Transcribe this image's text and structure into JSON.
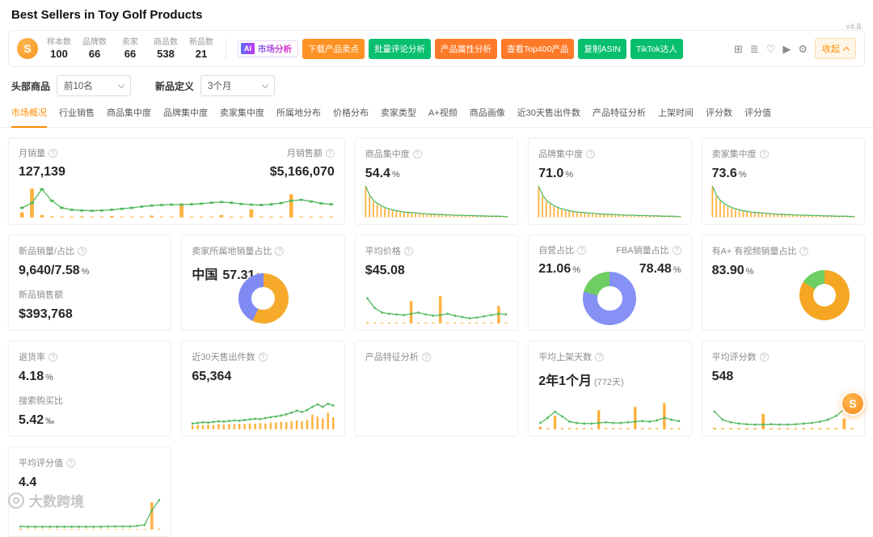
{
  "page": {
    "title": "Best Sellers in Toy Golf Products",
    "version": "v4.8.",
    "watermark": "大数跨境",
    "logo_letter": "S",
    "float_logo_letter": "S",
    "collapse_label": "收起"
  },
  "header": {
    "stats": [
      {
        "label": "样本数",
        "value": "100"
      },
      {
        "label": "品牌数",
        "value": "66"
      },
      {
        "label": "卖家",
        "value": "66"
      },
      {
        "label": "商品数",
        "value": "538"
      },
      {
        "label": "新品数",
        "value": "21"
      }
    ],
    "ai_button": {
      "badge": "AI",
      "label": "市场分析"
    },
    "buttons": [
      {
        "label": "下载产品卖点",
        "color": "#ff9224"
      },
      {
        "label": "批量评论分析",
        "color": "#08bf6e"
      },
      {
        "label": "产品属性分析",
        "color": "#ff7a28"
      },
      {
        "label": "查看Top400产品",
        "color": "#ff7a28"
      },
      {
        "label": "复制ASIN",
        "color": "#08bf6e"
      },
      {
        "label": "TikTok达人",
        "color": "#08bf6e"
      }
    ],
    "icons": {
      "grid": "⊞",
      "list": "≣",
      "heart": "♡",
      "video": "▶",
      "gear": "⚙"
    }
  },
  "filters": [
    {
      "label": "头部商品",
      "value": "前10名"
    },
    {
      "label": "新品定义",
      "value": "3个月"
    }
  ],
  "tabs": {
    "active_index": 0,
    "items": [
      "市场概况",
      "行业销售",
      "商品集中度",
      "品牌集中度",
      "卖家集中度",
      "所属地分布",
      "价格分布",
      "卖家类型",
      "A+视频",
      "商品画像",
      "近30天售出件数",
      "产品特征分析",
      "上架时间",
      "评分数",
      "评分值"
    ]
  },
  "cards": {
    "monthly": {
      "label": "月销量",
      "value": "127,139",
      "label2": "月销售额",
      "value2": "$5,166,070"
    },
    "product_concentration": {
      "label": "商品集中度",
      "value": "54.4",
      "unit": "%"
    },
    "brand_concentration": {
      "label": "品牌集中度",
      "value": "71.0",
      "unit": "%"
    },
    "seller_concentration": {
      "label": "卖家集中度",
      "value": "73.6",
      "unit": "%"
    },
    "new_product": {
      "label": "新品销量/占比",
      "value": "9,640/7.58",
      "unit": "%",
      "label2": "新品销售额",
      "value2": "$393,768"
    },
    "seller_location": {
      "label": "卖家所属地销量占比",
      "country": "中国",
      "value": "57.31",
      "unit": "%"
    },
    "avg_price": {
      "label": "平均价格",
      "value": "$45.08"
    },
    "fba": {
      "label": "自营占比",
      "value": "21.06",
      "unit": "%",
      "label2": "FBA销量占比",
      "value2": "78.48",
      "unit2": "%"
    },
    "aplus": {
      "label": "有A+ 有视频销量占比",
      "value": "83.90",
      "unit": "%"
    },
    "return_rate": {
      "label": "退货率",
      "value": "4.18",
      "unit": "%",
      "label2": "搜索购买比",
      "value2": "5.42",
      "unit2": "‰"
    },
    "sold_30d": {
      "label": "近30天售出件数",
      "value": "65,364"
    },
    "features": {
      "label": "产品特征分析"
    },
    "listing_days": {
      "label": "平均上架天数",
      "value": "2年1个月",
      "extra": "(772天)"
    },
    "rating_count": {
      "label": "平均评分数",
      "value": "548"
    },
    "rating_value": {
      "label": "平均评分值",
      "value": "4.4"
    }
  },
  "donuts": {
    "location": {
      "segments": [
        {
          "color": "#F7A92B",
          "pct": 57.31
        },
        {
          "color": "#7F8BF2",
          "pct": 42.69
        }
      ]
    },
    "fba": {
      "segments": [
        {
          "color": "#8690F5",
          "pct": 78.94
        },
        {
          "color": "#6FCE62",
          "pct": 21.06
        }
      ]
    },
    "aplus": {
      "segments": [
        {
          "color": "#F5A623",
          "pct": 83.9
        },
        {
          "color": "#6FCE62",
          "pct": 16.1
        }
      ]
    }
  },
  "chart_data": {
    "monthly_trend": {
      "type": "line+bar",
      "dots": true,
      "line": [
        30,
        45,
        88,
        52,
        30,
        24,
        22,
        21,
        22,
        24,
        27,
        30,
        34,
        37,
        39,
        40,
        40,
        41,
        43,
        46,
        48,
        46,
        42,
        40,
        39,
        41,
        45,
        52,
        55,
        50,
        44,
        41
      ],
      "bars": [
        16,
        90,
        8,
        4,
        3,
        3,
        4,
        3,
        3,
        5,
        3,
        3,
        3,
        6,
        3,
        3,
        44,
        3,
        3,
        3,
        8,
        3,
        3,
        26,
        3,
        3,
        3,
        72,
        3,
        3,
        3,
        3
      ]
    },
    "concentration_decay": {
      "type": "line+bar",
      "dots": false,
      "line": [
        98,
        70,
        54,
        44,
        37,
        31,
        27,
        24,
        21,
        19,
        17,
        16,
        15,
        14,
        13,
        12,
        11,
        10,
        10,
        9,
        9,
        8,
        8,
        7,
        7,
        7,
        6,
        6,
        6,
        5,
        5,
        5,
        4,
        4,
        4,
        4,
        3,
        3
      ],
      "bars": [
        96,
        66,
        50,
        41,
        34,
        29,
        25,
        22,
        20,
        18,
        16,
        15,
        14,
        13,
        12,
        11,
        10,
        10,
        9,
        9,
        8,
        8,
        7,
        7,
        6,
        6,
        6,
        5,
        5,
        5,
        4,
        4,
        4,
        4,
        3,
        3,
        3,
        3
      ]
    },
    "price_trend": {
      "type": "line+bar",
      "dots": true,
      "line": [
        78,
        48,
        34,
        30,
        28,
        26,
        30,
        34,
        28,
        24,
        26,
        30,
        24,
        20,
        16,
        18,
        22,
        26,
        30,
        28
      ],
      "bars": [
        4,
        3,
        3,
        3,
        3,
        3,
        70,
        3,
        3,
        3,
        85,
        3,
        3,
        3,
        3,
        3,
        3,
        3,
        55,
        3
      ]
    },
    "sold_30d_trend": {
      "type": "line+bar",
      "dots": true,
      "line": [
        18,
        20,
        22,
        21,
        23,
        25,
        24,
        26,
        28,
        27,
        29,
        31,
        33,
        32,
        35,
        38,
        40,
        43,
        47,
        52,
        58,
        54,
        60,
        70,
        78,
        70,
        80,
        74
      ],
      "bars": [
        12,
        14,
        13,
        15,
        14,
        16,
        15,
        17,
        16,
        18,
        17,
        19,
        18,
        20,
        19,
        21,
        22,
        24,
        23,
        26,
        28,
        25,
        30,
        46,
        40,
        34,
        52,
        38
      ]
    },
    "listing_days_trend": {
      "type": "line+bar",
      "dots": true,
      "line": [
        20,
        36,
        55,
        40,
        24,
        20,
        18,
        18,
        20,
        22,
        20,
        20,
        22,
        24,
        26,
        24,
        28,
        36,
        30,
        26
      ],
      "bars": [
        8,
        4,
        42,
        4,
        4,
        4,
        4,
        4,
        60,
        4,
        4,
        4,
        4,
        70,
        4,
        4,
        4,
        82,
        4,
        4
      ]
    },
    "rating_count_trend": {
      "type": "line+bar",
      "dots": true,
      "line": [
        55,
        30,
        22,
        18,
        16,
        15,
        15,
        16,
        15,
        15,
        16,
        18,
        20,
        24,
        30,
        42,
        62,
        86
      ],
      "bars": [
        5,
        4,
        4,
        4,
        4,
        4,
        48,
        4,
        4,
        4,
        4,
        4,
        4,
        4,
        4,
        4,
        34,
        4
      ]
    },
    "rating_value_trend": {
      "type": "line+bar",
      "dots": true,
      "line": [
        10,
        9,
        9,
        9,
        9,
        9,
        9,
        9,
        9,
        9,
        9,
        9,
        10,
        10,
        10,
        10,
        12,
        15,
        60,
        92
      ],
      "bars": [
        3,
        2,
        2,
        2,
        2,
        2,
        2,
        2,
        2,
        2,
        2,
        2,
        2,
        2,
        2,
        2,
        2,
        2,
        85,
        3
      ]
    }
  }
}
